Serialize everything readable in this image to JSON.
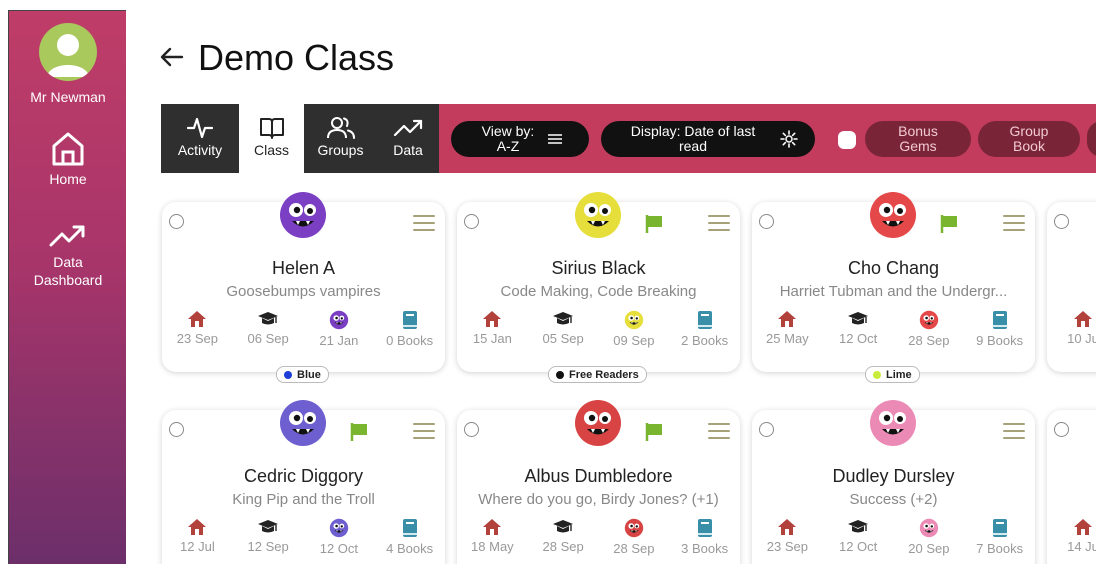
{
  "user": {
    "name": "Mr Newman"
  },
  "nav": [
    {
      "label": "Home",
      "icon": "home-icon"
    },
    {
      "label": "Data Dashboard",
      "icon": "trending-up-icon"
    }
  ],
  "header": {
    "back_icon": "arrow-left-icon",
    "title": "Demo Class"
  },
  "tabs": [
    {
      "label": "Activity",
      "icon": "activity-icon",
      "active": false
    },
    {
      "label": "Class",
      "icon": "book-open-icon",
      "active": true
    },
    {
      "label": "Groups",
      "icon": "users-icon",
      "active": false
    },
    {
      "label": "Data",
      "icon": "trending-up-icon",
      "active": false
    }
  ],
  "controls": {
    "view_by": "View by: A-Z",
    "display": "Display: Date of last read",
    "bonus_gems": "Bonus Gems",
    "group_book": "Group Book"
  },
  "colors": {
    "sidebar": "#b23a68",
    "toolbar": "#c33c5d",
    "flag": "#79b52e",
    "home_icon": "#b2403b",
    "books_icon": "#3a8fa8"
  },
  "students": [
    {
      "name": "Helen A",
      "book": "Goosebumps vampires",
      "flagged": false,
      "monster_color": "#7b3fc4",
      "home": "23 Sep",
      "school": "06 Sep",
      "monster_date": "21 Jan",
      "books": "0 Books",
      "group": "Blue",
      "group_color": "#1f3fd6"
    },
    {
      "name": "Sirius Black",
      "book": "Code Making, Code Breaking",
      "flagged": true,
      "monster_color": "#e6de3a",
      "home": "15 Jan",
      "school": "05 Sep",
      "monster_date": "09 Sep",
      "books": "2 Books",
      "group": "Free Readers",
      "group_color": "#111111"
    },
    {
      "name": "Cho Chang",
      "book": "Harriet Tubman and the Undergr...",
      "flagged": true,
      "monster_color": "#e44848",
      "home": "25 May",
      "school": "12 Oct",
      "monster_date": "28 Sep",
      "books": "9 Books",
      "group": "Lime",
      "group_color": "#c8ec3c"
    },
    {
      "name": "Cedric Diggory",
      "book": "King Pip and the Troll",
      "flagged": true,
      "monster_color": "#6d5fcf",
      "home": "12 Jul",
      "school": "12 Sep",
      "monster_date": "12 Oct",
      "books": "4 Books",
      "group": "",
      "group_color": ""
    },
    {
      "name": "Albus Dumbledore",
      "book": "Where do you go, Birdy Jones? (+1)",
      "flagged": true,
      "monster_color": "#d84444",
      "home": "18 May",
      "school": "28 Sep",
      "monster_date": "28 Sep",
      "books": "3 Books",
      "group": "",
      "group_color": ""
    },
    {
      "name": "Dudley Dursley",
      "book": "Success (+2)",
      "flagged": false,
      "monster_color": "#ec8ab6",
      "home": "23 Sep",
      "school": "12 Oct",
      "monster_date": "20 Sep",
      "books": "7 Books",
      "group": "",
      "group_color": ""
    }
  ],
  "partial_column": {
    "top_home": "10 Ju",
    "bottom_home": "14 Ju"
  }
}
